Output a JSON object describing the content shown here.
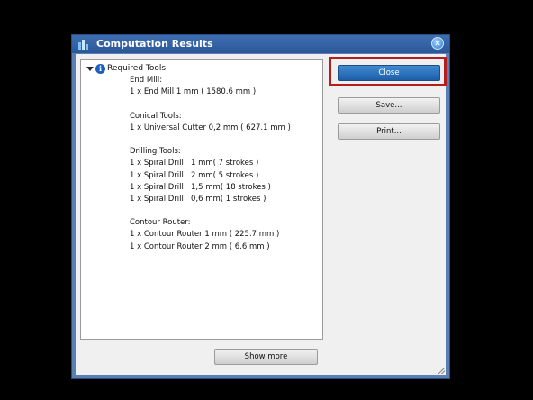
{
  "window": {
    "title": "Computation Results"
  },
  "tree": {
    "root_label": "Required Tools",
    "lines": [
      "End Mill:",
      "1 x End Mill 1 mm ( 1580.6 mm )",
      "",
      "Conical Tools:",
      "1 x Universal Cutter 0,2 mm ( 627.1 mm )",
      "",
      "Drilling Tools:",
      "1 x Spiral Drill   1 mm( 7 strokes )",
      "1 x Spiral Drill   2 mm( 5 strokes )",
      "1 x Spiral Drill   1,5 mm( 18 strokes )",
      "1 x Spiral Drill   0,6 mm( 1 strokes )",
      "",
      "Contour Router:",
      "1 x Contour Router 1 mm ( 225.7 mm )",
      "1 x Contour Router 2 mm ( 6.6 mm )"
    ]
  },
  "buttons": {
    "close": "Close",
    "save": "Save...",
    "print": "Print...",
    "show_more": "Show more"
  },
  "colors": {
    "highlight": "#b51e1e",
    "primary_button": "#2a6fbd"
  }
}
